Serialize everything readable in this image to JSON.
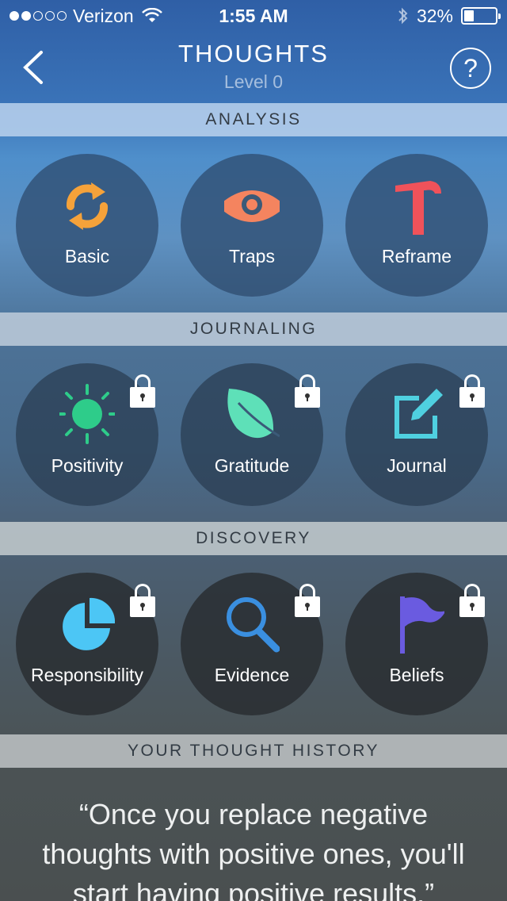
{
  "status_bar": {
    "carrier": "Verizon",
    "time": "1:55 AM",
    "battery": "32%",
    "battery_level": 0.32
  },
  "nav": {
    "title": "THOUGHTS",
    "subtitle": "Level 0",
    "help": "?"
  },
  "sections": {
    "analysis": "ANALYSIS",
    "journaling": "JOURNALING",
    "discovery": "DISCOVERY",
    "history": "YOUR THOUGHT HISTORY"
  },
  "tiles": {
    "basic": "Basic",
    "traps": "Traps",
    "reframe": "Reframe",
    "positivity": "Positivity",
    "gratitude": "Gratitude",
    "journal": "Journal",
    "responsibility": "Responsibility",
    "evidence": "Evidence",
    "beliefs": "Beliefs"
  },
  "icons": {
    "basic": "refresh-icon",
    "traps": "eye-icon",
    "reframe": "hammer-icon",
    "positivity": "sun-icon",
    "gratitude": "leaf-icon",
    "journal": "edit-icon",
    "responsibility": "pie-chart-icon",
    "evidence": "magnifier-icon",
    "beliefs": "flag-icon",
    "lock": "lock-icon"
  },
  "colors": {
    "basic": "#f5a23a",
    "traps": "#f4845f",
    "reframe": "#f0525a",
    "positivity": "#2ecc8a",
    "gratitude": "#5ee0b8",
    "journal": "#4fd0e0",
    "responsibility": "#4cc6f5",
    "evidence": "#3a8fe0",
    "beliefs": "#6a5be0"
  },
  "quote": "“Once you replace negative thoughts with positive ones, you'll start having positive results.”"
}
